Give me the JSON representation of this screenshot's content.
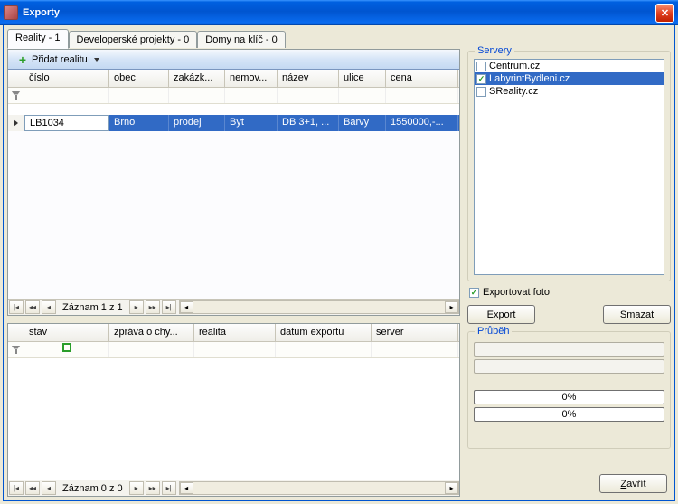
{
  "window": {
    "title": "Exporty"
  },
  "tabs": [
    {
      "label": "Reality - 1",
      "active": true
    },
    {
      "label": "Developerské projekty - 0",
      "active": false
    },
    {
      "label": "Domy na klíč - 0",
      "active": false
    }
  ],
  "toolbar": {
    "add_reality": "Přidat realitu"
  },
  "grid1": {
    "columns": [
      "číslo",
      "obec",
      "zakázk...",
      "nemov...",
      "název",
      "ulice",
      "cena"
    ],
    "row": {
      "cislo": "LB1034",
      "obec": "Brno",
      "zakazka": "prodej",
      "nemov": "Byt",
      "nazev": "DB 3+1, ...",
      "ulice": "Barvy",
      "cena": "1550000,-..."
    },
    "nav_text": "Záznam 1 z 1"
  },
  "grid2": {
    "columns": [
      "stav",
      "zpráva o chy...",
      "realita",
      "datum exportu",
      "server"
    ],
    "nav_text": "Záznam 0 z 0"
  },
  "servers": {
    "legend": "Servery",
    "items": [
      {
        "label": "Centrum.cz",
        "checked": false,
        "selected": false
      },
      {
        "label": "LabyrintBydleni.cz",
        "checked": true,
        "selected": true
      },
      {
        "label": "SReality.cz",
        "checked": false,
        "selected": false
      }
    ]
  },
  "export_foto": {
    "label": "Exportovat foto",
    "checked": true
  },
  "buttons": {
    "export": "Export",
    "smazat": "Smazat",
    "zavrit": "Zavřít"
  },
  "progress": {
    "legend": "Průběh",
    "pct1": "0%",
    "pct2": "0%"
  }
}
